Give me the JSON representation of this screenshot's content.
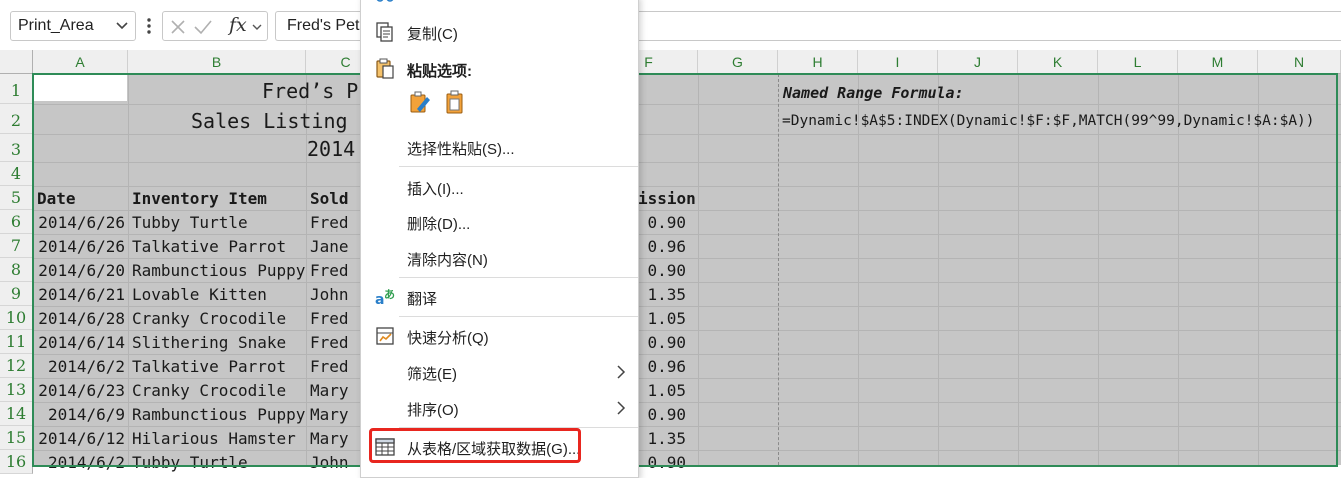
{
  "formula_bar": {
    "name_box": "Print_Area",
    "fx_label": "fx",
    "formula": "Fred's Pet"
  },
  "columns": [
    "A",
    "B",
    "C",
    "F",
    "G",
    "H",
    "I",
    "J",
    "K",
    "L",
    "M",
    "N"
  ],
  "rows": [
    "1",
    "2",
    "3",
    "4",
    "5",
    "6",
    "7",
    "8",
    "9",
    "10",
    "11",
    "12",
    "13",
    "14",
    "15",
    "16"
  ],
  "sheet": {
    "title1": "Fred’s P",
    "title2": "Sales Listing",
    "title3": "2014",
    "headers": {
      "date": "Date",
      "item": "Inventory Item",
      "sold": "Sold",
      "commission": "ission"
    },
    "named_range_label": "Named Range Formula:",
    "named_range_formula": "=Dynamic!$A$5:INDEX(Dynamic!$F:$F,MATCH(99^99,Dynamic!$A:$A))",
    "data_rows": [
      {
        "date": "2014/6/26",
        "item": "Tubby Turtle",
        "sold": "Fred",
        "commission": "0.90"
      },
      {
        "date": "2014/6/26",
        "item": "Talkative Parrot",
        "sold": "Jane",
        "commission": "0.96"
      },
      {
        "date": "2014/6/20",
        "item": "Rambunctious Puppy",
        "sold": "Fred",
        "commission": "0.90"
      },
      {
        "date": "2014/6/21",
        "item": "Lovable Kitten",
        "sold": "John",
        "commission": "1.35"
      },
      {
        "date": "2014/6/28",
        "item": "Cranky Crocodile",
        "sold": "Fred",
        "commission": "1.05"
      },
      {
        "date": "2014/6/14",
        "item": "Slithering Snake",
        "sold": "Fred",
        "commission": "0.90"
      },
      {
        "date": "2014/6/2",
        "item": "Talkative Parrot",
        "sold": "Fred",
        "commission": "0.96"
      },
      {
        "date": "2014/6/23",
        "item": "Cranky Crocodile",
        "sold": "Mary",
        "commission": "1.05"
      },
      {
        "date": "2014/6/9",
        "item": "Rambunctious Puppy",
        "sold": "Mary",
        "commission": "0.90"
      },
      {
        "date": "2014/6/12",
        "item": "Hilarious Hamster",
        "sold": "Mary",
        "commission": "1.35"
      },
      {
        "date": "2014/6/2",
        "item": "Tubby Turtle",
        "sold": "John",
        "commission": "0.90"
      }
    ]
  },
  "context_menu": {
    "copy": "复制(C)",
    "paste_options": "粘贴选项:",
    "paste_special": "选择性粘贴(S)...",
    "insert": "插入(I)...",
    "delete": "删除(D)...",
    "clear": "清除内容(N)",
    "translate": "翻译",
    "quick_analysis": "快速分析(Q)",
    "filter": "筛选(E)",
    "sort": "排序(O)",
    "get_data": "从表格/区域获取数据(G)..."
  },
  "colors": {
    "grid_bg": "#c6c6c6",
    "selection": "#2e8b57",
    "highlight": "#e8261f",
    "header_text": "#2e7d32"
  }
}
